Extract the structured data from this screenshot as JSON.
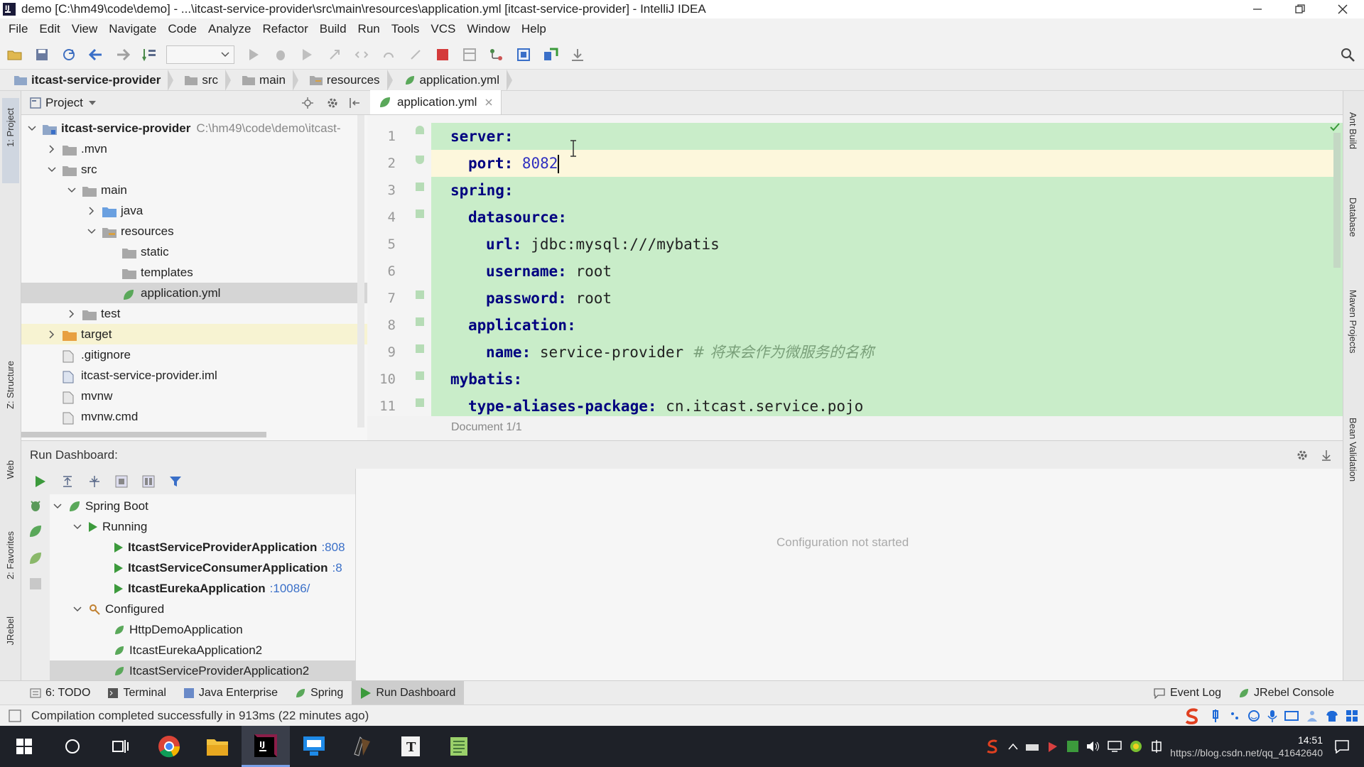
{
  "window": {
    "title": "demo [C:\\hm49\\code\\demo] - ...\\itcast-service-provider\\src\\main\\resources\\application.yml [itcast-service-provider] - IntelliJ IDEA"
  },
  "menu": [
    "File",
    "Edit",
    "View",
    "Navigate",
    "Code",
    "Analyze",
    "Refactor",
    "Build",
    "Run",
    "Tools",
    "VCS",
    "Window",
    "Help"
  ],
  "breadcrumb": [
    "itcast-service-provider",
    "src",
    "main",
    "resources",
    "application.yml"
  ],
  "project_panel": {
    "title": "Project",
    "root_name": "itcast-service-provider",
    "root_path": "C:\\hm49\\code\\demo\\itcast-",
    "items": {
      "mvn": ".mvn",
      "src": "src",
      "main": "main",
      "java": "java",
      "resources": "resources",
      "static": "static",
      "templates": "templates",
      "application": "application.yml",
      "test": "test",
      "target": "target",
      "gitignore": ".gitignore",
      "iml": "itcast-service-provider.iml",
      "mvnw": "mvnw",
      "mvnwcmd": "mvnw.cmd"
    }
  },
  "editor": {
    "tab": "application.yml",
    "lines": [
      {
        "n": "1",
        "key": "server:"
      },
      {
        "n": "2",
        "key": "port:",
        "value": "8082"
      },
      {
        "n": "3",
        "key": "spring:"
      },
      {
        "n": "4",
        "key": "datasource:"
      },
      {
        "n": "5",
        "key": "url:",
        "value": "jdbc:mysql:///mybatis"
      },
      {
        "n": "6",
        "key": "username:",
        "value": "root"
      },
      {
        "n": "7",
        "key": "password:",
        "value": "root"
      },
      {
        "n": "8",
        "key": "application:"
      },
      {
        "n": "9",
        "key": "name:",
        "value": "service-provider",
        "comment": "# 将来会作为微服务的名称"
      },
      {
        "n": "10",
        "key": "mybatis:"
      },
      {
        "n": "11",
        "key": "type-aliases-package:",
        "value": "cn.itcast.service.pojo"
      }
    ],
    "doc_status": "Document 1/1"
  },
  "run_dashboard": {
    "title": "Run Dashboard:",
    "spring_boot": "Spring Boot",
    "running": "Running",
    "apps_running": [
      {
        "name": "ItcastServiceProviderApplication",
        "port": ":808"
      },
      {
        "name": "ItcastServiceConsumerApplication",
        "port": ":8"
      },
      {
        "name": "ItcastEurekaApplication",
        "port": ":10086/"
      }
    ],
    "configured": "Configured",
    "apps_configured": [
      "HttpDemoApplication",
      "ItcastEurekaApplication2",
      "ItcastServiceProviderApplication2"
    ],
    "empty_message": "Configuration not started"
  },
  "side_tabs": {
    "left": [
      "1: Project",
      "Z: Structure",
      "Web",
      "2: Favorites",
      "JRebel"
    ],
    "right": [
      "Ant Build",
      "Database",
      "Maven Projects",
      "Bean Validation"
    ]
  },
  "bottom_tabs": [
    "6: TODO",
    "Terminal",
    "Java Enterprise",
    "Spring",
    "Run Dashboard"
  ],
  "bottom_right_tabs": [
    "Event Log",
    "JRebel Console"
  ],
  "status": "Compilation completed successfully in 913ms (22 minutes ago)",
  "taskbar": {
    "time": "14:51",
    "watermark": "https://blog.csdn.net/qq_41642640"
  },
  "colors": {
    "yaml_bg": "#c9edc9",
    "accent": "#2f65ca",
    "run_green": "#3c9a3c"
  }
}
